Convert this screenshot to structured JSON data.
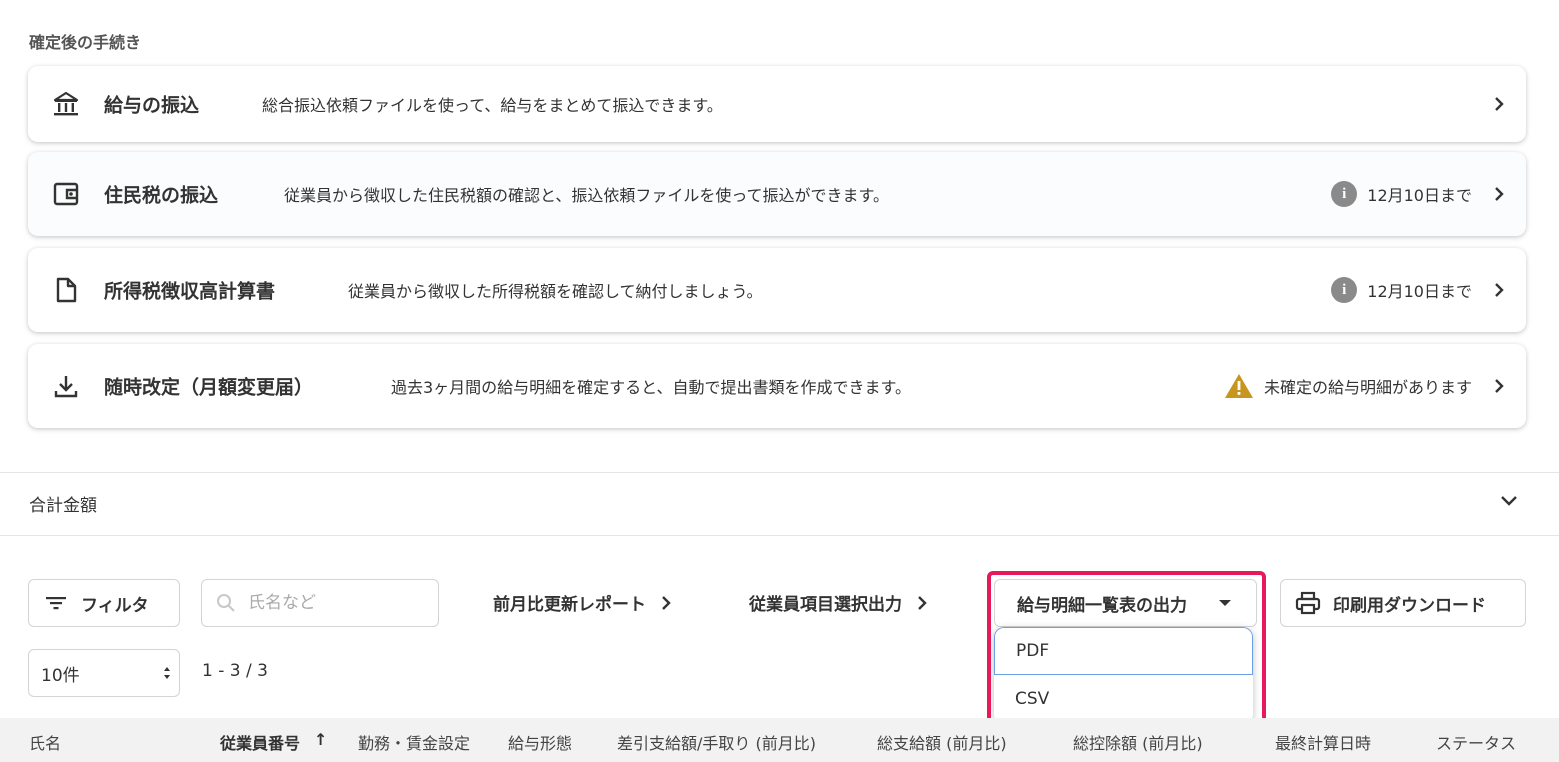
{
  "section_title": "確定後の手続き",
  "cards": [
    {
      "title": "給与の振込",
      "desc": "総合振込依頼ファイルを使って、給与をまとめて振込できます。",
      "status": ""
    },
    {
      "title": "住民税の振込",
      "desc": "従業員から徴収した住民税額の確認と、振込依頼ファイルを使って振込ができます。",
      "status": "12月10日まで"
    },
    {
      "title": "所得税徴収高計算書",
      "desc": "従業員から徴収した所得税額を確認して納付しましょう。",
      "status": "12月10日まで"
    },
    {
      "title": "随時改定（月額変更届）",
      "desc": "過去3ヶ月間の給与明細を確定すると、自動で提出書類を作成できます。",
      "status": "未確定の給与明細があります"
    }
  ],
  "info_glyph": "i",
  "total": {
    "label": "合計金額"
  },
  "toolbar": {
    "filter_label": "フィルタ",
    "search_placeholder": "氏名など",
    "report_link": "前月比更新レポート",
    "employee_export_link": "従業員項目選択出力",
    "payslip_export_label": "給与明細一覧表の出力",
    "print_download_label": "印刷用ダウンロード"
  },
  "export_menu": {
    "options": [
      "PDF",
      "CSV"
    ]
  },
  "pagination": {
    "page_size": "10件",
    "range": "1 - 3 / 3"
  },
  "table": {
    "columns": [
      "氏名",
      "従業員番号",
      "勤務・賃金設定",
      "給与形態",
      "差引支給額/手取り (前月比)",
      "総支給額 (前月比)",
      "総控除額 (前月比)",
      "最終計算日時",
      "ステータス"
    ],
    "sort_indicator": "↑"
  },
  "colors": {
    "highlight": "#e8195b",
    "warning": "#c8961e",
    "info": "#8a8a8a"
  }
}
